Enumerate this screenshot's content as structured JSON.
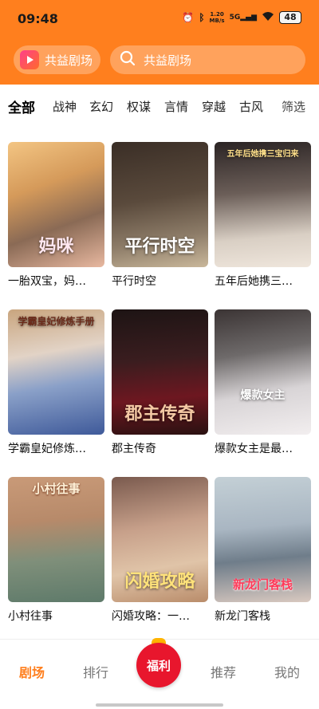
{
  "status_bar": {
    "time": "09:48",
    "net_speed_value": "1.20",
    "net_speed_unit": "MB/s",
    "network": "5G",
    "battery": "48"
  },
  "header": {
    "brand_label": "共益剧场",
    "search_placeholder": "共益剧场",
    "accent_color": "#ff7f1e"
  },
  "categories": {
    "items": [
      "全部",
      "战神",
      "玄幻",
      "权谋",
      "言情",
      "穿越",
      "古风"
    ],
    "filter_label": "筛选",
    "active": "全部"
  },
  "dramas": [
    {
      "title": "一胎双宝，妈…",
      "poster_text": "妈咪"
    },
    {
      "title": "平行时空",
      "poster_text": "平行时空"
    },
    {
      "title": "五年后她携三…",
      "poster_text": "五年后她携三宝归来"
    },
    {
      "title": "学霸皇妃修炼…",
      "poster_text": "学霸皇妃修炼手册"
    },
    {
      "title": "郡主传奇",
      "poster_text": "郡主传奇"
    },
    {
      "title": "爆款女主是最…",
      "poster_text": "爆款女主"
    },
    {
      "title": "小村往事",
      "poster_text": "小村往事"
    },
    {
      "title": "闪婚攻略：一…",
      "poster_text": "闪婚攻略"
    },
    {
      "title": "新龙门客栈",
      "poster_text": "新龙门客栈"
    }
  ],
  "tabbar": {
    "theater": "剧场",
    "ranking": "排行",
    "welfare": "福利",
    "recommend": "推荐",
    "mine": "我的"
  }
}
